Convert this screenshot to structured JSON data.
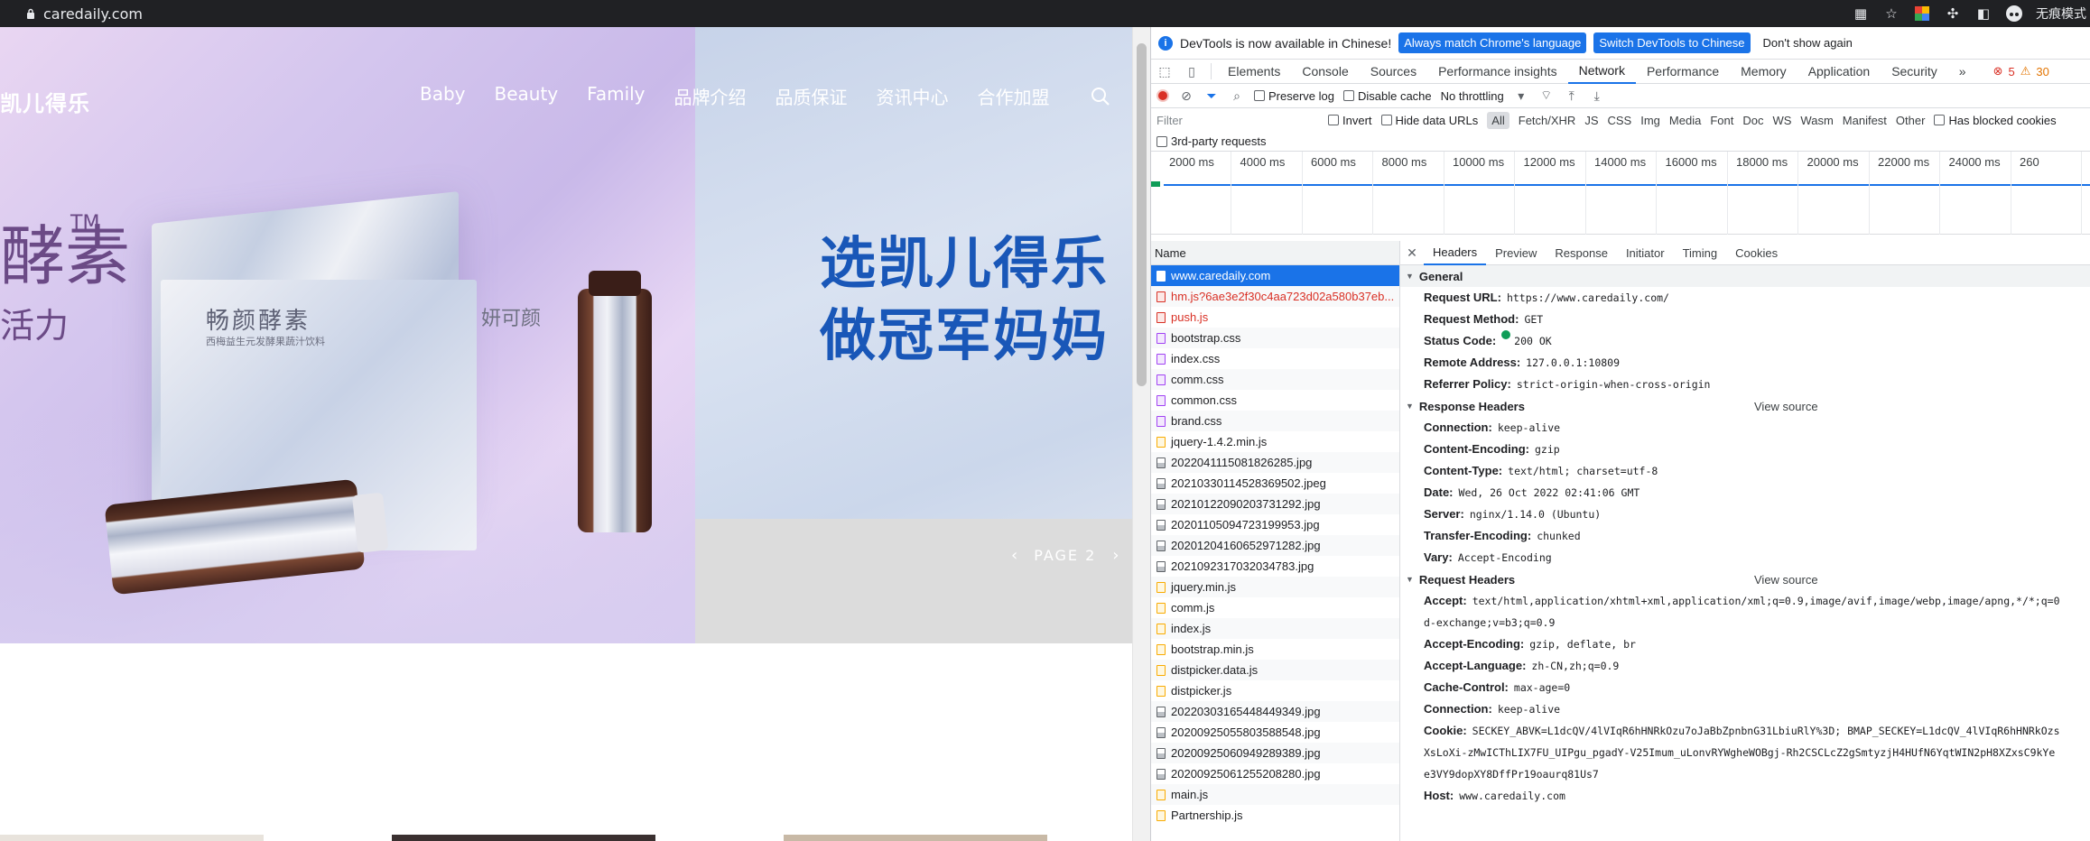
{
  "browser": {
    "url": "caredaily.com",
    "profile_label": "无痕模式"
  },
  "site": {
    "logo": "凯儿得乐",
    "nav": [
      "Baby",
      "Beauty",
      "Family",
      "品牌介绍",
      "品质保证",
      "资讯中心",
      "合作加盟"
    ],
    "hero": {
      "big_char": "酵素",
      "tm": "TM",
      "sub_char": "活力",
      "product_title": "畅颜酵素",
      "product_sub": "西梅益生元发酵果蔬汁饮料",
      "product_brand": "妍可颜"
    },
    "slide": {
      "slogan_line1": "选凯儿得乐",
      "slogan_line2": "做冠军妈妈",
      "pager_label": "PAGE 2"
    }
  },
  "devtools": {
    "infobar": {
      "message": "DevTools is now available in Chinese!",
      "btn_match": "Always match Chrome's language",
      "btn_switch": "Switch DevTools to Chinese",
      "btn_dismiss": "Don't show again"
    },
    "tabs": [
      "Elements",
      "Console",
      "Sources",
      "Performance insights",
      "Network",
      "Performance",
      "Memory",
      "Application",
      "Security"
    ],
    "active_tab": "Network",
    "errors": "5",
    "warnings": "30",
    "toolbar": {
      "preserve_log": "Preserve log",
      "disable_cache": "Disable cache",
      "throttling": "No throttling"
    },
    "filter": {
      "placeholder": "Filter",
      "invert": "Invert",
      "hide_data_urls": "Hide data URLs",
      "types": [
        "All",
        "Fetch/XHR",
        "JS",
        "CSS",
        "Img",
        "Media",
        "Font",
        "Doc",
        "WS",
        "Wasm",
        "Manifest",
        "Other"
      ],
      "blocked_cookies": "Has blocked cookies",
      "third_party": "3rd-party requests"
    },
    "timeline_ticks": [
      "2000 ms",
      "4000 ms",
      "6000 ms",
      "8000 ms",
      "10000 ms",
      "12000 ms",
      "14000 ms",
      "16000 ms",
      "18000 ms",
      "20000 ms",
      "22000 ms",
      "24000 ms",
      "260"
    ],
    "name_header": "Name",
    "requests": [
      {
        "name": "www.caredaily.com",
        "type": "doc",
        "selected": true
      },
      {
        "name": "hm.js?6ae3e2f30c4aa723d02a580b37eb...",
        "type": "xhr",
        "error": true
      },
      {
        "name": "push.js",
        "type": "xhr",
        "error": true
      },
      {
        "name": "bootstrap.css",
        "type": "css"
      },
      {
        "name": "index.css",
        "type": "css"
      },
      {
        "name": "comm.css",
        "type": "css"
      },
      {
        "name": "common.css",
        "type": "css"
      },
      {
        "name": "brand.css",
        "type": "css"
      },
      {
        "name": "jquery-1.4.2.min.js",
        "type": "js"
      },
      {
        "name": "20220411150818​26285.jpg",
        "type": "img"
      },
      {
        "name": "20210330114528369502.jpeg",
        "type": "img"
      },
      {
        "name": "20210122090203731292.jpg",
        "type": "img"
      },
      {
        "name": "20201105094723199953.jpg",
        "type": "img"
      },
      {
        "name": "20201204160652971282.jpg",
        "type": "img"
      },
      {
        "name": "20210923170320347​83.jpg",
        "type": "img"
      },
      {
        "name": "jquery.min.js",
        "type": "js"
      },
      {
        "name": "comm.js",
        "type": "js"
      },
      {
        "name": "index.js",
        "type": "js"
      },
      {
        "name": "bootstrap.min.js",
        "type": "js"
      },
      {
        "name": "distpicker.data.js",
        "type": "js"
      },
      {
        "name": "distpicker.js",
        "type": "js"
      },
      {
        "name": "20220303165448449349.jpg",
        "type": "img"
      },
      {
        "name": "20200925055803588548.jpg",
        "type": "img"
      },
      {
        "name": "20200925060949289389.jpg",
        "type": "img"
      },
      {
        "name": "20200925061255208280.jpg",
        "type": "img"
      },
      {
        "name": "main.js",
        "type": "js"
      },
      {
        "name": "Partnership.js",
        "type": "js"
      }
    ],
    "detail_tabs": [
      "Headers",
      "Preview",
      "Response",
      "Initiator",
      "Timing",
      "Cookies"
    ],
    "general": {
      "title": "General",
      "rows": [
        {
          "k": "Request URL:",
          "v": "https://www.caredaily.com/"
        },
        {
          "k": "Request Method:",
          "v": "GET"
        },
        {
          "k": "Status Code:",
          "v": "200 OK",
          "status": true
        },
        {
          "k": "Remote Address:",
          "v": "127.0.0.1:10809"
        },
        {
          "k": "Referrer Policy:",
          "v": "strict-origin-when-cross-origin"
        }
      ]
    },
    "response_headers": {
      "title": "Response Headers",
      "view_source": "View source",
      "rows": [
        {
          "k": "Connection:",
          "v": "keep-alive"
        },
        {
          "k": "Content-Encoding:",
          "v": "gzip"
        },
        {
          "k": "Content-Type:",
          "v": "text/html; charset=utf-8"
        },
        {
          "k": "Date:",
          "v": "Wed, 26 Oct 2022 02:41:06 GMT"
        },
        {
          "k": "Server:",
          "v": "nginx/1.14.0 (Ubuntu)"
        },
        {
          "k": "Transfer-Encoding:",
          "v": "chunked"
        },
        {
          "k": "Vary:",
          "v": "Accept-Encoding"
        }
      ]
    },
    "request_headers": {
      "title": "Request Headers",
      "view_source": "View source",
      "accept_k": "Accept:",
      "accept_v": "text/html,application/xhtml+xml,application/xml;q=0.9,image/avif,image/webp,image/apng,*/*;q=0",
      "accept_cont": "d-exchange;v=b3;q=0.9",
      "rows": [
        {
          "k": "Accept-Encoding:",
          "v": "gzip, deflate, br"
        },
        {
          "k": "Accept-Language:",
          "v": "zh-CN,zh;q=0.9"
        },
        {
          "k": "Cache-Control:",
          "v": "max-age=0"
        },
        {
          "k": "Connection:",
          "v": "keep-alive"
        }
      ],
      "cookie_k": "Cookie:",
      "cookie_v": "SECKEY_ABVK=L1dcQV/4lVIqR6hHNRkOzu7oJaBbZpnbnG31LbiuRlY%3D; BMAP_SECKEY=L1dcQV_4lVIqR6hHNRkOzs",
      "cookie_cont1": "XsLoXi-zMwICThLIX7FU_UIPgu_pgadY-V25Imum_uLonvRYWgheWOBgj-Rh2CSCLcZ2gSmtyzjH4HUfN6YqtWIN2pH8XZxsC9kYe",
      "cookie_cont2": "e3VY9dopXY8DffPr19oaurq81Us7",
      "host_k": "Host:",
      "host_v": "www.caredaily.com"
    }
  }
}
